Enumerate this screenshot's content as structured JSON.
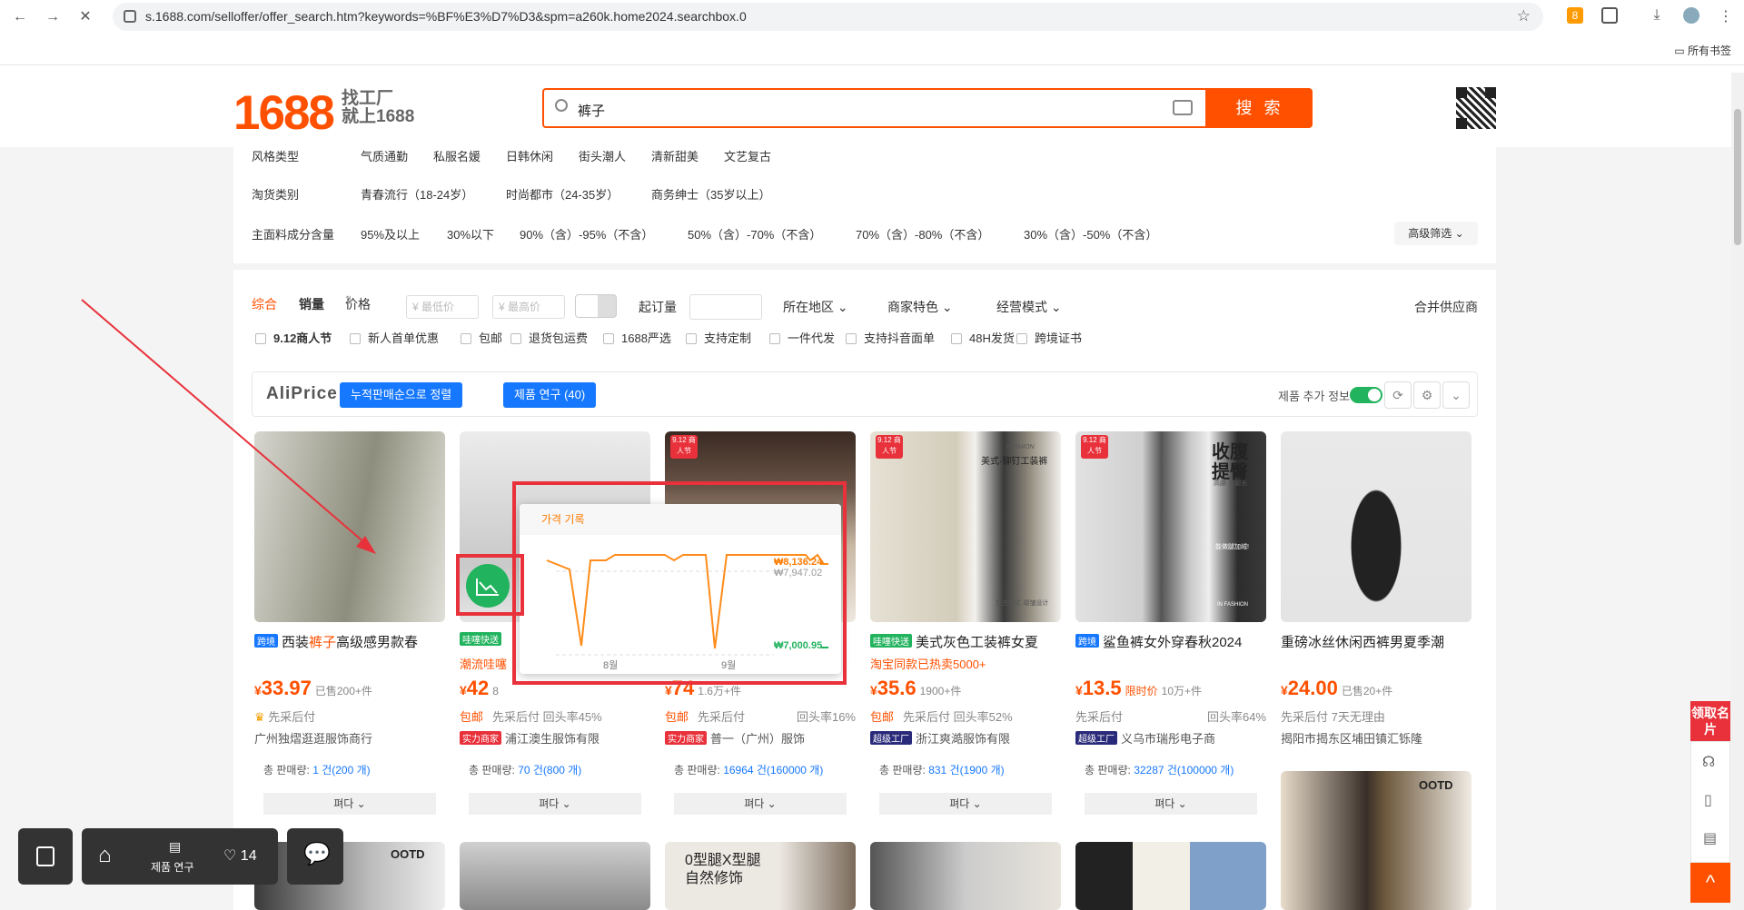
{
  "browser": {
    "url": "s.1688.com/selloffer/offer_search.htm?keywords=%BF%E3%D7%D3&spm=a260k.home2024.searchbox.0",
    "bookmarks_label": "所有书签",
    "ext_badge": "8"
  },
  "header": {
    "logo": "1688",
    "slogan_line1": "找工厂",
    "slogan_line2": "就上1688",
    "search_value": "裤子",
    "search_button": "搜 索"
  },
  "filters": {
    "rows": [
      {
        "label": "风格类型",
        "options": [
          "气质通勤",
          "私服名媛",
          "日韩休闲",
          "街头潮人",
          "清新甜美",
          "文艺复古"
        ]
      },
      {
        "label": "淘货类别",
        "options": [
          "青春流行（18-24岁）",
          "时尚都市（24-35岁）",
          "商务绅士（35岁以上）"
        ]
      },
      {
        "label": "主面料成分含量",
        "options": [
          "95%及以上",
          "30%以下",
          "90%（含）-95%（不含）",
          "50%（含）-70%（不含）",
          "70%（含）-80%（不含）",
          "30%（含）-50%（不含）"
        ]
      }
    ],
    "advanced": "高级筛选"
  },
  "sort": {
    "items": [
      "综合",
      "销量",
      "价格"
    ],
    "min_price_placeholder": "¥ 最低价",
    "max_price_placeholder": "¥ 最高价",
    "moq": "起订量",
    "dropdowns": [
      "所在地区",
      "商家特色",
      "经营模式"
    ],
    "merge": "合并供应商"
  },
  "checkboxes": [
    "9.12商人节",
    "新人首单优惠",
    "包邮",
    "退货包运费",
    "1688严选",
    "支持定制",
    "一件代发",
    "支持抖音面单",
    "48H发货",
    "跨境证书"
  ],
  "aliprice": {
    "brand": "AliPrice",
    "btn_sort": "누적판매순으로 정렬",
    "btn_research": "제품 연구 (40)",
    "extra_info": "제품 추가 정보"
  },
  "products": [
    {
      "tag": "跨境",
      "title_pre": "西装",
      "title_hl": "裤子",
      "title_post": "高级感男款春",
      "sub": "",
      "price": "33.97",
      "sold": "已售200+件",
      "lim": "",
      "svc_left": "先采后付",
      "svc_right": "",
      "pkg": "",
      "shop": "广州独熠逛逛服饰商行",
      "badge": "",
      "sales_label": "총 판매량:",
      "sales_val": "1 건(200 개)",
      "fold": "펴다"
    },
    {
      "tag": "哇噻快送",
      "title_pre": "",
      "title_hl": "",
      "title_post": "",
      "sub": "潮流哇噻",
      "price": "42",
      "sold": "8",
      "lim": "",
      "svc_left": "先采后付 回头率45%",
      "svc_right": "",
      "pkg": "包邮",
      "shop": "浦江澳生服饰有限",
      "badge": "实力商家",
      "sales_label": "총 판매량:",
      "sales_val": "70 건(800 개)",
      "fold": "펴다"
    },
    {
      "tag": "",
      "title_pre": "",
      "title_hl": "",
      "title_post": "",
      "sub": "",
      "price": "74",
      "sold": "1.6万+件",
      "lim": "",
      "svc_left": "先采后付",
      "svc_right": "回头率16%",
      "pkg": "包邮",
      "shop": "普一（广州）服饰",
      "badge": "实力商家",
      "sales_label": "총 판매량:",
      "sales_val": "16964 건(160000 개)",
      "fold": "펴다"
    },
    {
      "tag": "哇噻快送",
      "title_pre": "美式灰色工装裤女夏",
      "title_hl": "",
      "title_post": "",
      "sub": "淘宝同款已热卖5000+",
      "price": "35.6",
      "sold": "1900+件",
      "lim": "",
      "svc_left": "先采后付 回头率52%",
      "svc_right": "",
      "pkg": "包邮",
      "shop": "浙江爽澔服饰有限",
      "badge": "超级工厂",
      "sales_label": "총 판매량:",
      "sales_val": "831 건(1900 개)",
      "fold": "펴다"
    },
    {
      "tag": "跨境",
      "title_pre": "鲨鱼裤女外穿春秋2024",
      "title_hl": "",
      "title_post": "",
      "sub": "",
      "price": "13.5",
      "sold": "10万+件",
      "lim": "限时价",
      "svc_left": "先采后付",
      "svc_right": "回头率64%",
      "pkg": "",
      "shop": "义乌市瑞彤电子商",
      "badge": "超级工厂",
      "sales_label": "총 판매량:",
      "sales_val": "32287 건(100000 개)",
      "fold": "펴다"
    },
    {
      "tag": "",
      "title_pre": "重磅冰丝休闲西裤男夏季潮",
      "title_hl": "",
      "title_post": "",
      "sub": "",
      "price": "24.00",
      "sold": "已售20+件",
      "lim": "",
      "svc_left": "先采后付 7天无理由",
      "svc_right": "",
      "pkg": "",
      "shop": "揭阳市揭东区埔田镇汇铄隆",
      "badge": "",
      "sales_label": "",
      "sales_val": "",
      "fold": ""
    }
  ],
  "badges912": "9.12 商人节",
  "img_texts": {
    "p4_fashion": "FASHION",
    "p4_title": "美式·铆钉工装裤",
    "p4_bottom": "复古美式·褶皱设计",
    "p5_t1": "收腹",
    "p5_t2": "提臀",
    "p5_sub": "高腰·显腿长",
    "p5_inner": "能做腿加绒!",
    "p5_brand": "IN FASHION",
    "ootd": "OOTD",
    "row2_text1": "0型腿X型腿",
    "row2_text2": "自然修饰"
  },
  "popup": {
    "title": "가격 기록",
    "price_high": "₩8,136.24",
    "price_mid": "₩7,947.02",
    "price_low": "₩7,000.95",
    "x_labels": [
      "8월",
      "9월"
    ]
  },
  "bottombar": {
    "research": "제품 연구",
    "likes": "14"
  },
  "rightpanel": {
    "card_label": "领取名片"
  }
}
